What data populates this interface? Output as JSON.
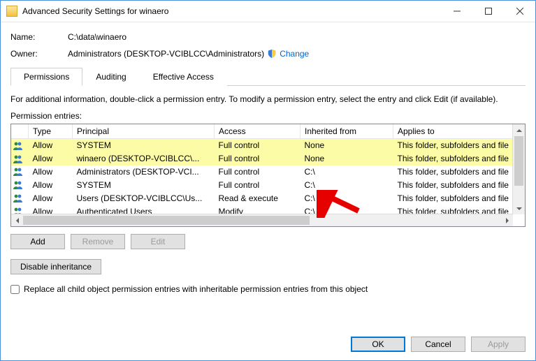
{
  "window": {
    "title": "Advanced Security Settings for winaero"
  },
  "info": {
    "nameLabel": "Name:",
    "nameValue": "C:\\data\\winaero",
    "ownerLabel": "Owner:",
    "ownerValue": "Administrators (DESKTOP-VCIBLCC\\Administrators)",
    "changeLink": "Change"
  },
  "tabs": {
    "permissions": "Permissions",
    "auditing": "Auditing",
    "effective": "Effective Access"
  },
  "text": {
    "instructions": "For additional information, double-click a permission entry. To modify a permission entry, select the entry and click Edit (if available).",
    "entriesLabel": "Permission entries:",
    "replaceCheckbox": "Replace all child object permission entries with inheritable permission entries from this object"
  },
  "columns": {
    "type": "Type",
    "principal": "Principal",
    "access": "Access",
    "inherited": "Inherited from",
    "applies": "Applies to"
  },
  "entries": [
    {
      "type": "Allow",
      "principal": "SYSTEM",
      "access": "Full control",
      "inherited": "None",
      "applies": "This folder, subfolders and file",
      "highlight": true
    },
    {
      "type": "Allow",
      "principal": "winaero (DESKTOP-VCIBLCC\\...",
      "access": "Full control",
      "inherited": "None",
      "applies": "This folder, subfolders and file",
      "highlight": true
    },
    {
      "type": "Allow",
      "principal": "Administrators (DESKTOP-VCI...",
      "access": "Full control",
      "inherited": "C:\\",
      "applies": "This folder, subfolders and file",
      "highlight": false
    },
    {
      "type": "Allow",
      "principal": "SYSTEM",
      "access": "Full control",
      "inherited": "C:\\",
      "applies": "This folder, subfolders and file",
      "highlight": false
    },
    {
      "type": "Allow",
      "principal": "Users (DESKTOP-VCIBLCC\\Us...",
      "access": "Read & execute",
      "inherited": "C:\\",
      "applies": "This folder, subfolders and file",
      "highlight": false
    },
    {
      "type": "Allow",
      "principal": "Authenticated Users",
      "access": "Modify",
      "inherited": "C:\\",
      "applies": "This folder, subfolders and file",
      "highlight": false
    }
  ],
  "buttons": {
    "add": "Add",
    "remove": "Remove",
    "edit": "Edit",
    "disableInheritance": "Disable inheritance",
    "ok": "OK",
    "cancel": "Cancel",
    "apply": "Apply"
  }
}
